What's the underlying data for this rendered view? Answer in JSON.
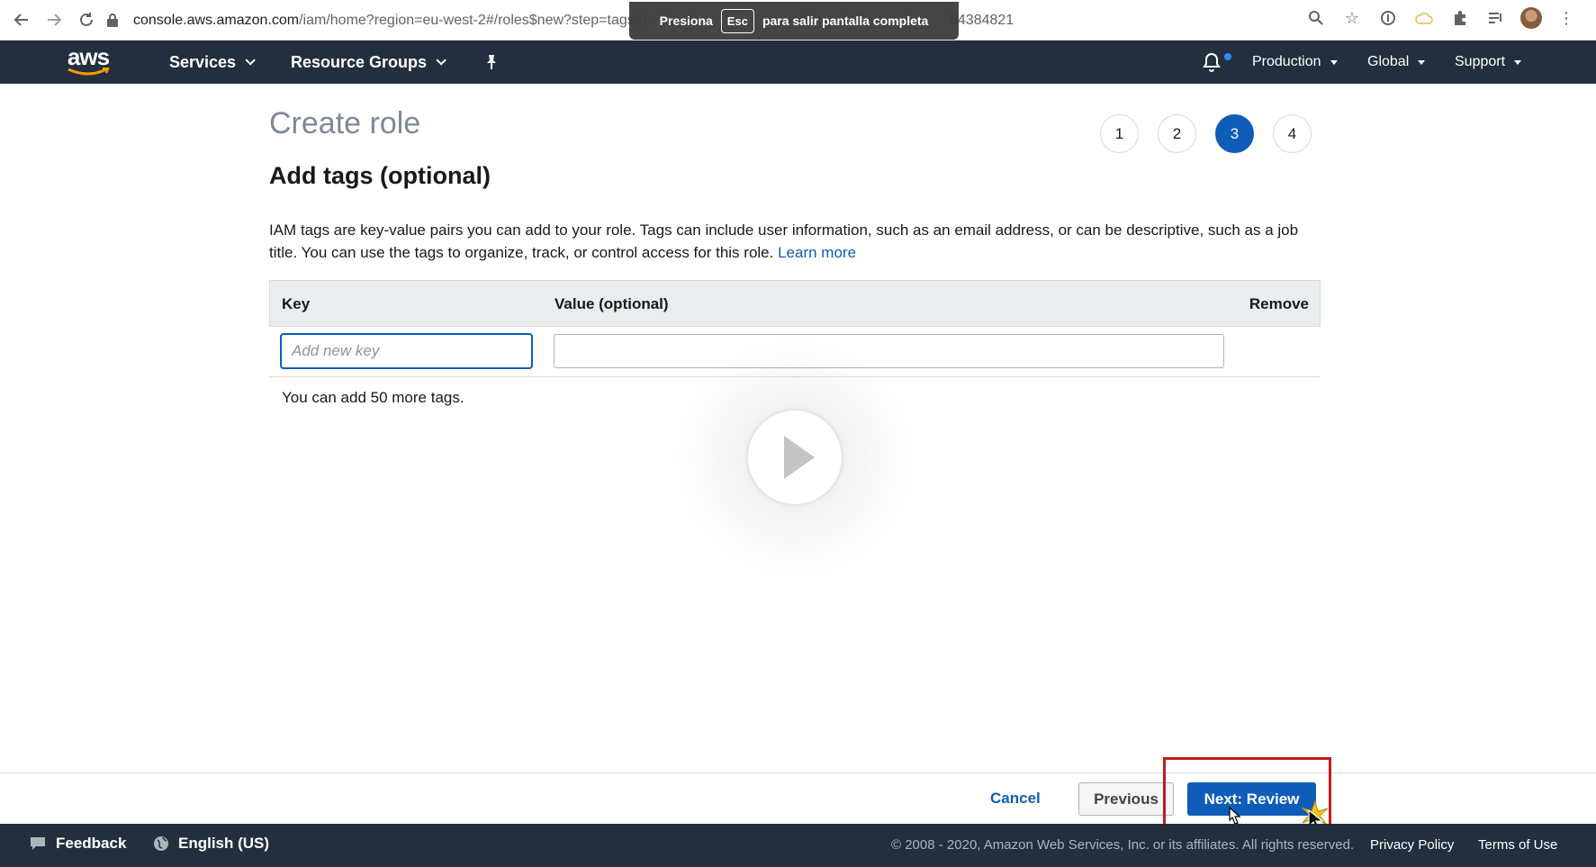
{
  "browser": {
    "url_host": "console.aws.amazon.com",
    "url_path": "/iam/home?region=eu-west-2#/roles$new?step=tags&r",
    "url_tail": "54384821",
    "fullscreen_toast": {
      "pre": "Presiona",
      "key": "Esc",
      "post": "para salir pantalla completa"
    }
  },
  "aws_nav": {
    "logo_text": "aws",
    "services": "Services",
    "resource_groups": "Resource Groups",
    "account": "Production",
    "region": "Global",
    "support": "Support"
  },
  "page": {
    "title": "Create role",
    "steps": [
      "1",
      "2",
      "3",
      "4"
    ],
    "active_step": 3,
    "section_title": "Add tags (optional)",
    "description": "IAM tags are key-value pairs you can add to your role. Tags can include user information, such as an email address, or can be descriptive, such as a job title. You can use the tags to organize, track, or control access for this role.",
    "learn_more": "Learn more"
  },
  "tags_table": {
    "headers": {
      "key": "Key",
      "value": "Value (optional)",
      "remove": "Remove"
    },
    "key_placeholder": "Add new key",
    "value_placeholder": "",
    "note": "You can add 50 more tags."
  },
  "actions": {
    "cancel": "Cancel",
    "previous": "Previous",
    "next": "Next: Review"
  },
  "footer": {
    "feedback": "Feedback",
    "language": "English (US)",
    "copyright": "© 2008 - 2020, Amazon Web Services, Inc. or its affiliates. All rights reserved.",
    "privacy": "Privacy Policy",
    "terms": "Terms of Use"
  },
  "colors": {
    "aws_nav_bg": "#232f3e",
    "primary_blue": "#0f5db8",
    "highlight_red": "#c41a1a"
  }
}
